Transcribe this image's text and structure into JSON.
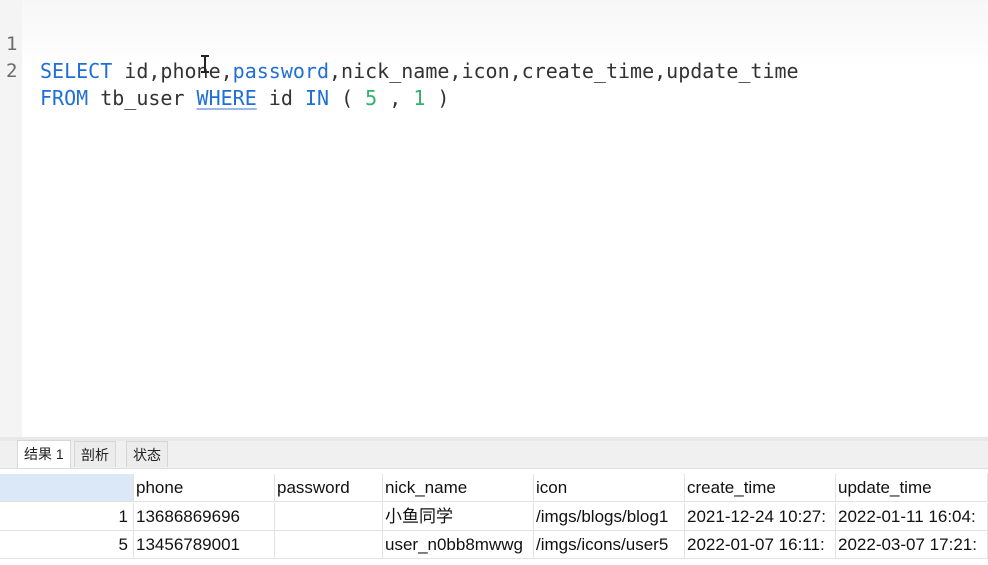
{
  "editor": {
    "lines": [
      {
        "number": "1",
        "tokens": [
          {
            "text": "SELECT",
            "cls": "kw"
          },
          {
            "text": " id,phone,",
            "cls": "plain"
          },
          {
            "text": "password",
            "cls": "kw"
          },
          {
            "text": ",nick_name,icon,create_time,update_time",
            "cls": "plain"
          }
        ]
      },
      {
        "number": "2",
        "tokens": [
          {
            "text": "FROM",
            "cls": "kw"
          },
          {
            "text": " tb_user ",
            "cls": "plain"
          },
          {
            "text": "WHERE",
            "cls": "kw ul"
          },
          {
            "text": " id ",
            "cls": "plain"
          },
          {
            "text": "IN",
            "cls": "kw"
          },
          {
            "text": " ( ",
            "cls": "plain"
          },
          {
            "text": "5",
            "cls": "num"
          },
          {
            "text": " , ",
            "cls": "plain"
          },
          {
            "text": "1",
            "cls": "num"
          },
          {
            "text": " )",
            "cls": "plain"
          }
        ]
      }
    ]
  },
  "tabs": [
    {
      "label": "结果 1",
      "active": true
    },
    {
      "label": "剖析",
      "active": false
    },
    {
      "label": "状态",
      "active": false
    }
  ],
  "grid": {
    "columns": [
      "",
      "phone",
      "password",
      "nick_name",
      "icon",
      "create_time",
      "update_time"
    ],
    "rows": [
      [
        "1",
        "13686869696",
        "",
        "小鱼同学",
        "/imgs/blogs/blog1",
        "2021-12-24 10:27:",
        "2022-01-11 16:04:"
      ],
      [
        "5",
        "13456789001",
        "",
        "user_n0bb8mwwg",
        "/imgs/icons/user5",
        "2022-01-07 16:11:",
        "2022-03-07 17:21:"
      ]
    ]
  },
  "colors": {
    "keyword": "#1f6fd6",
    "number": "#2fb36a",
    "text": "#333333",
    "header_rownum_bg": "#dbe8f8"
  }
}
